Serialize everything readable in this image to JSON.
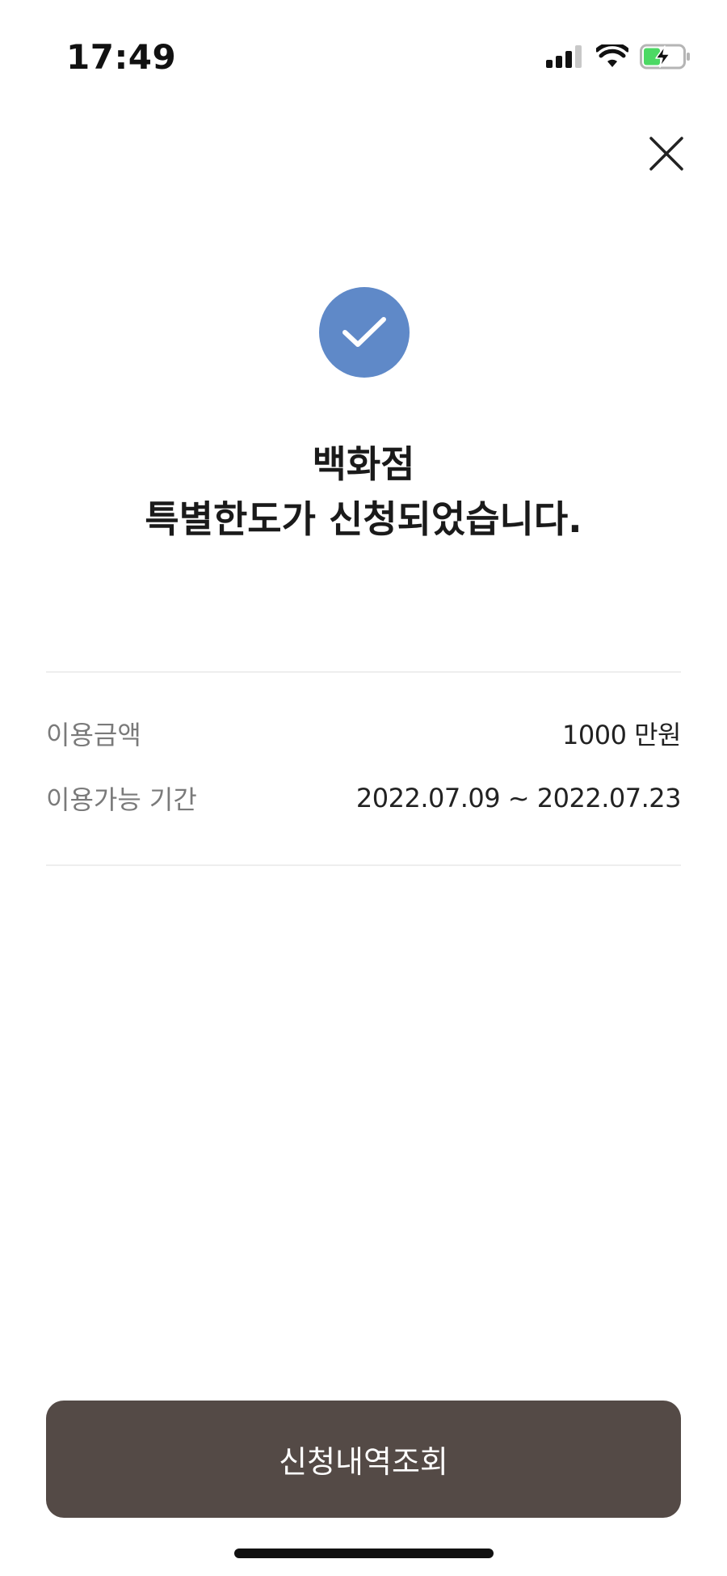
{
  "status_bar": {
    "time": "17:49",
    "icons": [
      "cellular-signal-icon",
      "wifi-icon",
      "battery-charging-icon"
    ]
  },
  "header": {
    "close_icon": "close-icon"
  },
  "result": {
    "icon": "check-icon",
    "title_line1": "백화점",
    "title_line2": "특별한도가 신청되었습니다."
  },
  "details": {
    "rows": [
      {
        "label": "이용금액",
        "value": "1000 만원"
      },
      {
        "label": "이용가능 기간",
        "value": "2022.07.09 ~ 2022.07.23"
      }
    ]
  },
  "footer": {
    "button_label": "신청내역조회"
  },
  "colors": {
    "accent_check": "#5f89c8",
    "button_bg": "#544a46",
    "title_text": "#1a1a1a",
    "label_text": "#7a7a7a"
  }
}
